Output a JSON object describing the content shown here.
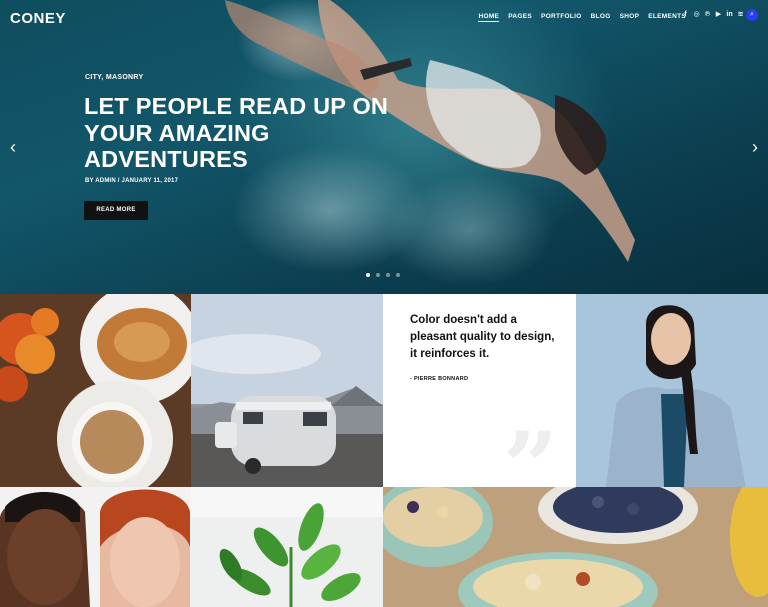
{
  "header": {
    "logo": "CONEY",
    "nav": [
      "HOME",
      "PAGES",
      "PORTFOLIO",
      "BLOG",
      "SHOP",
      "ELEMENTS"
    ],
    "active_nav": "HOME",
    "social_icons": [
      "facebook-icon",
      "instagram-icon",
      "pinterest-icon",
      "youtube-icon",
      "linkedin-icon",
      "rss-icon"
    ],
    "search_icon": "search-icon"
  },
  "hero": {
    "category": "CITY, MASONRY",
    "title": "LET PEOPLE READ UP ON YOUR AMAZING ADVENTURES",
    "meta": "BY ADMIN / JANUARY 11, 2017",
    "button": "READ MORE",
    "slides": 4,
    "active_slide": 1,
    "prev_icon": "chevron-left-icon",
    "next_icon": "chevron-right-icon"
  },
  "quote": {
    "text": "Color doesn't add a pleasant quality to design, it reinforces it.",
    "author": "- PIERRE BONNARD"
  },
  "colors": {
    "accent": "#2a3cf0",
    "button_bg": "#111111",
    "hero_water": "#12566a"
  }
}
